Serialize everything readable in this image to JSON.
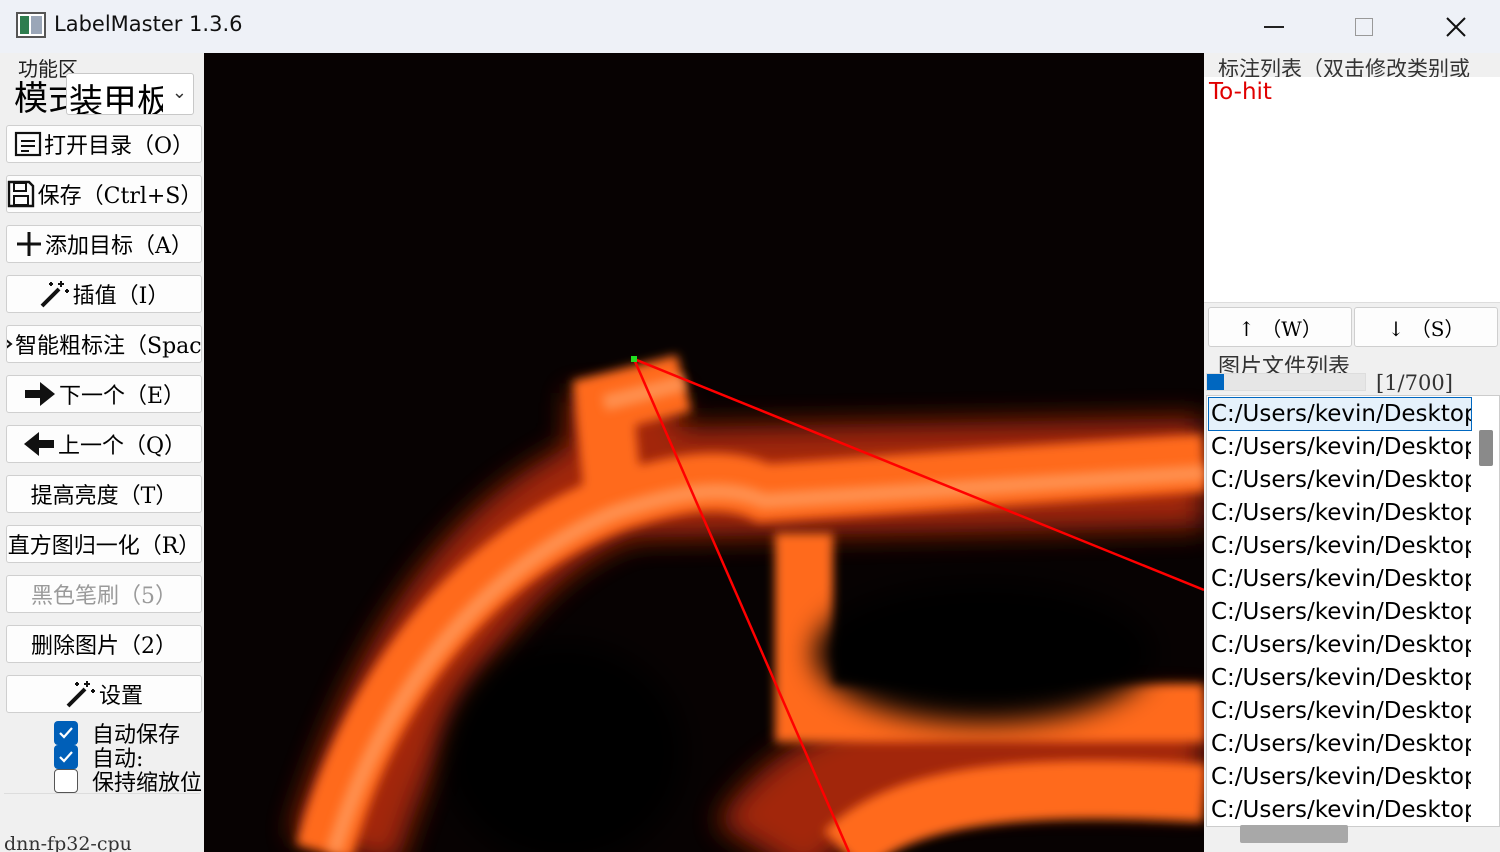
{
  "window": {
    "title": "LabelMaster 1.3.6",
    "minimize_icon": "minimize-icon",
    "maximize_icon": "maximize-icon",
    "close_icon": "close-icon"
  },
  "left_panel": {
    "group_title": "功能区",
    "mode_label": "模式",
    "mode_select_value": "装甲板",
    "buttons": [
      {
        "label": "打开目录（O）",
        "icon": "document-icon",
        "enabled": true
      },
      {
        "label": "保存（Ctrl+S）",
        "icon": "floppy-icon",
        "enabled": true
      },
      {
        "label": "添加目标（A）",
        "icon": "plus-icon",
        "enabled": true
      },
      {
        "label": "插值（I）",
        "icon": "magic-wand-icon",
        "enabled": true
      },
      {
        "label": "智能粗标注（Space）",
        "icon": "sparkle-icon",
        "enabled": true
      },
      {
        "label": "下一个（E）",
        "icon": "arrow-right-icon",
        "enabled": true
      },
      {
        "label": "上一个（Q）",
        "icon": "arrow-left-icon",
        "enabled": true
      },
      {
        "label": "提高亮度（T）",
        "icon": "",
        "enabled": true
      },
      {
        "label": "直方图归一化（R）",
        "icon": "",
        "enabled": true
      },
      {
        "label": "黑色笔刷（5）",
        "icon": "",
        "enabled": false
      },
      {
        "label": "删除图片（2）",
        "icon": "",
        "enabled": true
      },
      {
        "label": "设置",
        "icon": "magic-wand-icon",
        "enabled": true
      }
    ],
    "checkboxes": [
      {
        "label": "自动保存",
        "checked": true
      },
      {
        "label": "自动:",
        "checked": true
      },
      {
        "label": "保持缩放位",
        "checked": false
      }
    ],
    "status_text": "dnn-fp32-cpu"
  },
  "right_panel": {
    "annotation_title": "标注列表（双击修改类别或",
    "annotations": [
      "To-hit"
    ],
    "annotation_color": "#e00000",
    "up_button": "↑ （W）",
    "down_button": "↓ （S）",
    "files_title": "图片文件列表",
    "progress_fraction": 0.0014,
    "file_count": "[1/700]",
    "files": [
      "C:/Users/kevin/Desktop",
      "C:/Users/kevin/Desktop",
      "C:/Users/kevin/Desktop",
      "C:/Users/kevin/Desktop",
      "C:/Users/kevin/Desktop",
      "C:/Users/kevin/Desktop",
      "C:/Users/kevin/Desktop",
      "C:/Users/kevin/Desktop",
      "C:/Users/kevin/Desktop",
      "C:/Users/kevin/Desktop",
      "C:/Users/kevin/Desktop",
      "C:/Users/kevin/Desktop",
      "C:/Users/kevin/Desktop"
    ]
  },
  "colors": {
    "accent": "#0067c0",
    "annotation_line": "#ff0000",
    "glow": "#ff6a1a"
  }
}
